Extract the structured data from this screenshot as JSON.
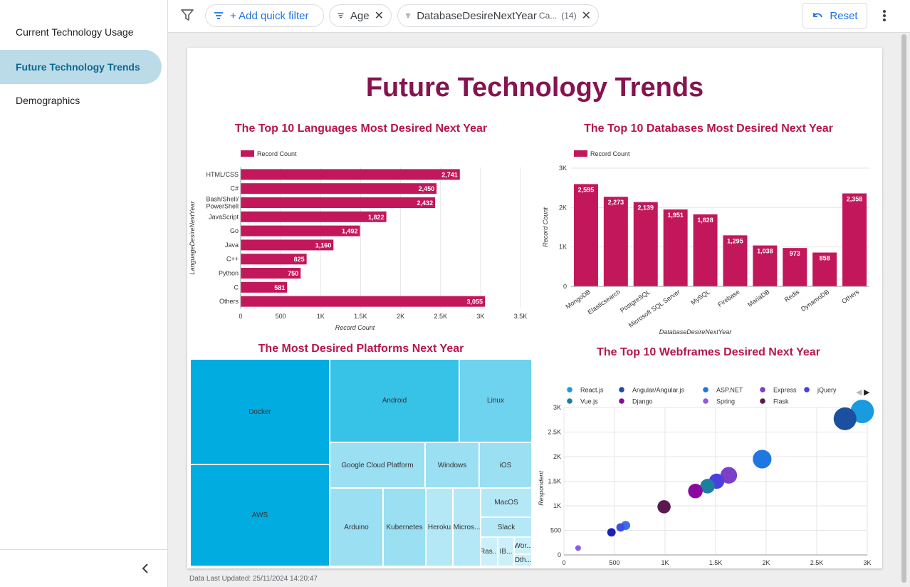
{
  "sidebar": {
    "items": [
      {
        "label": "Current Technology Usage",
        "active": false
      },
      {
        "label": "Future Technology Trends",
        "active": true
      },
      {
        "label": "Demographics",
        "active": false
      }
    ],
    "collapse_icon": "chevron-left-icon"
  },
  "filter_bar": {
    "filter_icon": "filter-icon",
    "add_filter_label": "+ Add quick filter",
    "chips": [
      {
        "label": "Age",
        "sub": "",
        "count": ""
      },
      {
        "label": "DatabaseDesireNextYear",
        "sub": "Ca...",
        "count": "(14)"
      }
    ],
    "reset_label": "Reset",
    "more_icon": "more-vert-icon"
  },
  "report": {
    "title": "Future Technology Trends",
    "last_updated": "Data Last Updated: 25/11/2024 14:20:47"
  },
  "colors": {
    "bar": "#c2185b",
    "title": "#86144f",
    "chart_title": "#b5164f",
    "treemap": [
      "#00ace0",
      "#37c3e8",
      "#6dd3ee",
      "#9bdff2",
      "#b5e8f6",
      "#ccf0f9"
    ]
  },
  "chart_data": [
    {
      "type": "bar",
      "orientation": "horizontal",
      "title": "The Top 10 Languages Most Desired Next Year",
      "legend": "Record Count",
      "xlabel": "Record Count",
      "ylabel": "LanguageDesireNextYear",
      "categories": [
        "HTML/CSS",
        "C#",
        "Bash/Shell/ PowerShell",
        "JavaScript",
        "Go",
        "Java",
        "C++",
        "Python",
        "C",
        "Others"
      ],
      "values": [
        2741,
        2450,
        2432,
        1822,
        1492,
        1160,
        825,
        750,
        581,
        3055
      ],
      "value_labels": [
        "2,741",
        "2,450",
        "2,432",
        "1,822",
        "1,492",
        "1,160",
        "825",
        "750",
        "581",
        "3,055"
      ],
      "xticks": [
        "0",
        "500",
        "1K",
        "1.5K",
        "2K",
        "2.5K",
        "3K",
        "3.5K"
      ],
      "xlim": [
        0,
        3500
      ]
    },
    {
      "type": "bar",
      "orientation": "vertical",
      "title": "The Top 10 Databases Most Desired Next Year",
      "legend": "Record Count",
      "xlabel": "DatabaseDesireNextYear",
      "ylabel": "Record Count",
      "categories": [
        "MongoDB",
        "Elasticsearch",
        "PostgreSQL",
        "Microsoft SQL Server",
        "MySQL",
        "Firebase",
        "MariaDB",
        "Redis",
        "DynamoDB",
        "Others"
      ],
      "values": [
        2595,
        2273,
        2139,
        1951,
        1828,
        1295,
        1038,
        973,
        858,
        2358
      ],
      "value_labels": [
        "2,595",
        "2,273",
        "2,139",
        "1,951",
        "1,828",
        "1,295",
        "1,038",
        "973",
        "858",
        "2,358"
      ],
      "yticks": [
        "0",
        "1K",
        "2K",
        "3K"
      ],
      "ylim": [
        0,
        3000
      ]
    },
    {
      "type": "treemap",
      "title": "The Most Desired Platforms Next Year",
      "items": [
        "Docker",
        "AWS",
        "Android",
        "Linux",
        "Google Cloud Platform",
        "Windows",
        "iOS",
        "Arduino",
        "Kubernetes",
        "Heroku",
        "Micros...",
        "MacOS",
        "Slack",
        "Ras...",
        "IB...",
        "Wor...",
        "Oth..."
      ]
    },
    {
      "type": "scatter",
      "title": "The Top 10 Webframes Desired Next Year",
      "xlabel": "Record Count",
      "ylabel": "Respondent",
      "xticks": [
        "0",
        "500",
        "1K",
        "1.5K",
        "2K",
        "2.5K",
        "3K"
      ],
      "yticks": [
        "0",
        "500",
        "1K",
        "1.5K",
        "2K",
        "2.5K",
        "3K"
      ],
      "xlim": [
        0,
        3000
      ],
      "ylim": [
        0,
        3000
      ],
      "series": [
        {
          "name": "React.js",
          "color": "#1a9be0",
          "x": 2950,
          "y": 2920,
          "size": 3.5
        },
        {
          "name": "Angular/Angular.js",
          "color": "#1b4fa0",
          "x": 2780,
          "y": 2770,
          "size": 3.4
        },
        {
          "name": "ASP.NET",
          "color": "#1e78e0",
          "x": 1960,
          "y": 1950,
          "size": 2.8
        },
        {
          "name": "Express",
          "color": "#7b3fc8",
          "x": 1630,
          "y": 1620,
          "size": 2.5
        },
        {
          "name": "jQuery",
          "color": "#4c3fe0",
          "x": 1510,
          "y": 1500,
          "size": 2.3
        },
        {
          "name": "Vue.js",
          "color": "#1a7fa0",
          "x": 1420,
          "y": 1400,
          "size": 2.2
        },
        {
          "name": "Django",
          "color": "#8a0aa0",
          "x": 1300,
          "y": 1300,
          "size": 2.2
        },
        {
          "name": "Spring",
          "color": "#8b5ce0",
          "x": 140,
          "y": 140,
          "size": 0.9
        },
        {
          "name": "Flask",
          "color": "#5a1a50",
          "x": 990,
          "y": 980,
          "size": 2.0
        },
        {
          "name": "",
          "color": "#3b6ee8",
          "x": 610,
          "y": 600,
          "size": 1.4
        },
        {
          "name": "",
          "color": "#3b50e0",
          "x": 560,
          "y": 560,
          "size": 1.3
        },
        {
          "name": "",
          "color": "#1a22b0",
          "x": 470,
          "y": 460,
          "size": 1.3
        }
      ]
    }
  ]
}
